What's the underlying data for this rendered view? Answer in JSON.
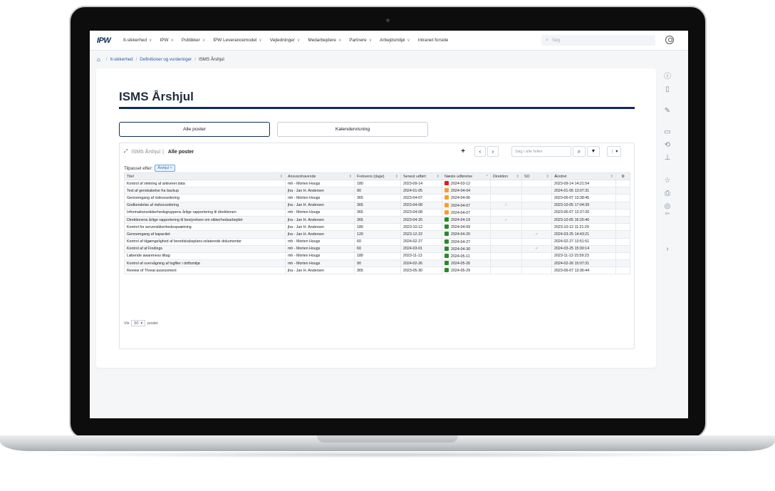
{
  "nav": {
    "logo": "IPW",
    "items": [
      {
        "label": "It-sikkerhed",
        "chevron": "∨"
      },
      {
        "label": "IPW",
        "chevron": "∨"
      },
      {
        "label": "Politikker",
        "chevron": "∨"
      },
      {
        "label": "IPW Leverancemodel",
        "chevron": "∨"
      },
      {
        "label": "Vejledninger",
        "chevron": "∨"
      },
      {
        "label": "Medarbejdere",
        "chevron": "∨"
      },
      {
        "label": "Partnere",
        "chevron": "∨"
      },
      {
        "label": "Arbejdsmiljø",
        "chevron": "∨"
      },
      {
        "label": "Intranet forside",
        "chevron": ""
      }
    ],
    "search_placeholder": "Søg"
  },
  "breadcrumb": {
    "items": [
      "It-sikkerhed",
      "Definitioner og vurderinger",
      "ISMS Årshjul"
    ]
  },
  "page": {
    "title": "ISMS Årshjul",
    "tabs": [
      "Alle poster",
      "Kalendervisning"
    ]
  },
  "grid": {
    "list_name": "ISMS Årshjul",
    "separator": "|",
    "view_name": "Alle poster",
    "search_placeholder": "Søg i alle felter",
    "filter_label": "Tilpasset efter:",
    "filter_chip": "Årshjul ×",
    "columns": [
      "Titel",
      "Ansvarshavende",
      "Frekvens (dage)",
      "Senest udført",
      "Næste udførelse",
      "Direktion",
      "SO",
      "Ændret"
    ],
    "rows": [
      {
        "title": "Kontrol af sletning af arkiveret data",
        "owner": "mh - Morten Hougs",
        "freq": "180",
        "last": "2023-09-14",
        "next": "2024-03-12",
        "status": "#d6211f",
        "dir": "",
        "so": "",
        "changed": "2023-09-14 14:21:54"
      },
      {
        "title": "Test af genskabelse fra backup",
        "owner": "jha - Jan H. Andersen",
        "freq": "90",
        "last": "2024-01-05",
        "next": "2024-04-04",
        "status": "#f0a030",
        "dir": "",
        "so": "",
        "changed": "2024-01-05 13:07:31"
      },
      {
        "title": "Gennemgang af risikovurdering",
        "owner": "mh - Morten Hougs",
        "freq": "365",
        "last": "2023-04-07",
        "next": "2024-04-06",
        "status": "#f0a030",
        "dir": "",
        "so": "",
        "changed": "2023-06-07 13:38:45"
      },
      {
        "title": "Godkendelse af risikovurdering",
        "owner": "jha - Jan H. Andersen",
        "freq": "365",
        "last": "2023-04-08",
        "next": "2024-04-07",
        "status": "#f0a030",
        "dir": "✓",
        "so": "",
        "changed": "2023-10-05 17:04:39"
      },
      {
        "title": "Informationssikkerhedsgruppens årlige rapportering til direktionen",
        "owner": "mh - Morten Hougs",
        "freq": "365",
        "last": "2023-04-08",
        "next": "2024-04-07",
        "status": "#f0a030",
        "dir": "",
        "so": "",
        "changed": "2023-06-07 13:37:20"
      },
      {
        "title": "Direktionens årlige rapportering til bestyrelsen om sikkerhedsarbejdet",
        "owner": "jha - Jan H. Andersen",
        "freq": "365",
        "last": "2023-04-20",
        "next": "2024-04-19",
        "status": "#2a8a2a",
        "dir": "✓",
        "so": "",
        "changed": "2023-10-05 16:25:40"
      },
      {
        "title": "Kontrol for serversikkerhedsopsætning",
        "owner": "jha - Jan H. Andersen",
        "freq": "180",
        "last": "2023-10-12",
        "next": "2024-04-09",
        "status": "#2a8a2a",
        "dir": "",
        "so": "",
        "changed": "2023-10-12 11:21:29"
      },
      {
        "title": "Gennemgang af kapacitet",
        "owner": "jha - Jan H. Andersen",
        "freq": "120",
        "last": "2023-12-22",
        "next": "2024-04-20",
        "status": "#2a8a2a",
        "dir": "",
        "so": "✓",
        "changed": "2024-03-25 14:43:21"
      },
      {
        "title": "Kontrol af tilgængelighed af beredskabsplans-relaterede dokumenter",
        "owner": "mh - Morten Hougs",
        "freq": "60",
        "last": "2024-02-27",
        "next": "2024-04-27",
        "status": "#2a8a2a",
        "dir": "",
        "so": "",
        "changed": "2024-02-27 13:51:51"
      },
      {
        "title": "Kontrol af af Findings",
        "owner": "mh - Morten Hougs",
        "freq": "60",
        "last": "2024-03-01",
        "next": "2024-04-30",
        "status": "#2a8a2a",
        "dir": "",
        "so": "✓",
        "changed": "2024-03-25 15:00:14"
      },
      {
        "title": "Løbende awareness tiltag",
        "owner": "mh - Morten Hougs",
        "freq": "180",
        "last": "2023-11-13",
        "next": "2024-05-11",
        "status": "#2a8a2a",
        "dir": "",
        "so": "",
        "changed": "2023-11-13 15:59:23"
      },
      {
        "title": "Kontrol af overvågning af logfiler i driftsmiljø",
        "owner": "mh - Morten Hougs",
        "freq": "90",
        "last": "2024-02-26",
        "next": "2024-05-26",
        "status": "#2a8a2a",
        "dir": "",
        "so": "",
        "changed": "2024-02-26 15:07:31"
      },
      {
        "title": "Review of Threat assessment",
        "owner": "jha - Jan H. Andersen",
        "freq": "365",
        "last": "2023-05-30",
        "next": "2024-05-29",
        "status": "#2a8a2a",
        "dir": "",
        "so": "",
        "changed": "2023-06-07 13:36:44"
      }
    ],
    "footer": {
      "prefix": "Vis",
      "page_size": "50",
      "suffix": "poster"
    }
  },
  "rail": {
    "da_label": "DA"
  }
}
